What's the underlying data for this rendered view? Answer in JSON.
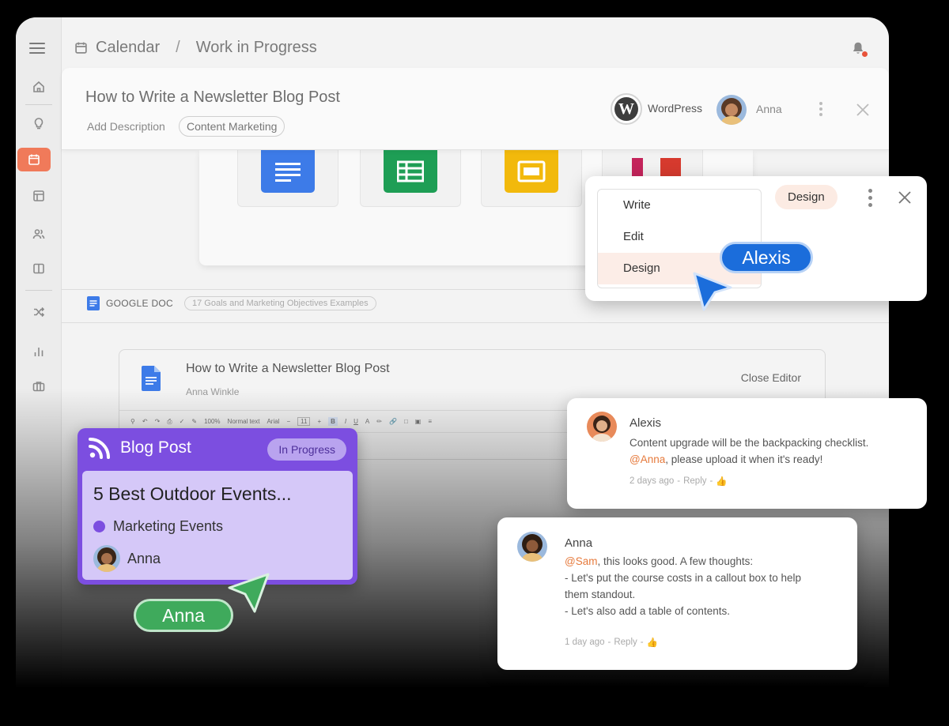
{
  "breadcrumb": {
    "section": "Calendar",
    "separator": "/",
    "page": "Work in Progress"
  },
  "task": {
    "title": "How to Write a Newsletter Blog Post",
    "add_description": "Add Description",
    "tag": "Content Marketing",
    "platform": "WordPress",
    "assignee": "Anna"
  },
  "doc_section": {
    "type_label": "GOOGLE DOC",
    "linked_doc": "17 Goals and Marketing Objectives Examples"
  },
  "editor": {
    "title": "How to Write a Newsletter Blog Post",
    "author": "Anna Winkle",
    "close_label": "Close Editor",
    "zoom": "100%",
    "style": "Normal text",
    "font": "Arial",
    "size": "11"
  },
  "blog_card": {
    "type": "Blog Post",
    "status": "In Progress",
    "post_title": "5 Best Outdoor Events...",
    "category": "Marketing Events",
    "user": "Anna"
  },
  "cursors": {
    "anna": "Anna",
    "alexis": "Alexis"
  },
  "role_popover": {
    "items": [
      "Write",
      "Edit",
      "Design"
    ],
    "selected": "Design",
    "badge": "Design"
  },
  "comments": [
    {
      "author": "Alexis",
      "line1": "Content upgrade will be the backpacking checklist.",
      "mention": "@Anna",
      "line2_rest": ", please upload it when it's ready!",
      "time": "2 days ago",
      "reply": "Reply"
    },
    {
      "author": "Anna",
      "mention": "@Sam",
      "line1_rest": ", this looks good. A few thoughts:",
      "line2": "- Let's put the course costs in a callout box to help",
      "line3": "them standout.",
      "line4": "- Let's also add a table of contents.",
      "time": "1 day ago",
      "reply": "Reply"
    }
  ],
  "colors": {
    "accent": "#f07a5a",
    "purple": "#7c4ee0",
    "anna_cursor": "#3faa5c",
    "alexis_cursor": "#1b6ddb",
    "mention": "#e67a3c"
  }
}
